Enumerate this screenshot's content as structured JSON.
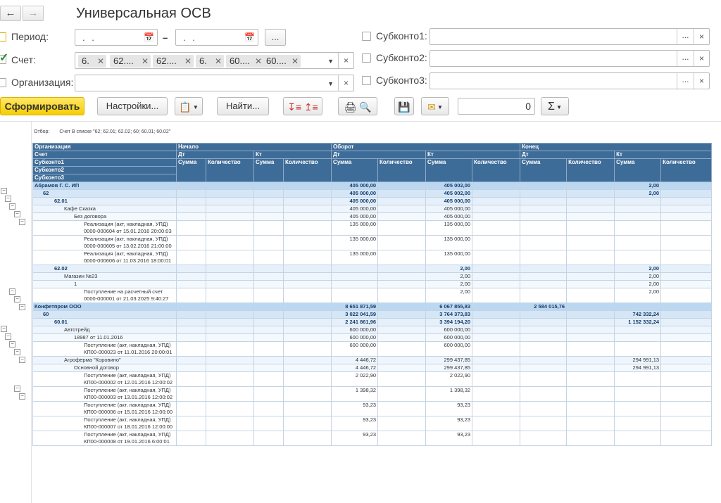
{
  "window": {
    "title": "Универсальная ОСВ"
  },
  "nav": {
    "back": "🡐",
    "forward": "🡒"
  },
  "form": {
    "period_label": "Период:",
    "period_from": ". .",
    "period_to": ". .",
    "period_dash": "–",
    "period_more": "...",
    "account_label": "Счет:",
    "account_chips": [
      "6.",
      "62....",
      "62....",
      "6.",
      "60....",
      "60...."
    ],
    "org_label": "Организация:",
    "sub1_label": "Субконто1:",
    "sub2_label": "Субконто2:",
    "sub3_label": "Субконто3:",
    "dots": "...",
    "clear": "×"
  },
  "toolbar": {
    "run": "Сформировать",
    "settings": "Настройки...",
    "find": "Найти...",
    "counter": "0"
  },
  "report": {
    "filter_label": "Отбор:",
    "filter_text": "Счет В списке \"62; 62.01; 62.02; 60; 60.01; 60.02\"",
    "header": {
      "org": "Организация",
      "account": "Счет",
      "sub1": "Субконто1",
      "sub2": "Субконто2",
      "sub3": "Субконто3",
      "start": "Начало",
      "turnover": "Оборот",
      "end": "Конец",
      "dt": "Дт",
      "kt": "Кт",
      "sum": "Сумма",
      "qty": "Количество"
    },
    "rows": [
      {
        "lvl": "l0",
        "indent": "",
        "name": "Абрамов Г. С. ИП",
        "v": [
          "",
          "",
          "",
          "",
          "405 000,00",
          "",
          "405 002,00",
          "",
          "",
          "",
          "2,00",
          ""
        ]
      },
      {
        "lvl": "l1",
        "indent": "i1",
        "name": "62",
        "v": [
          "",
          "",
          "",
          "",
          "405 000,00",
          "",
          "405 002,00",
          "",
          "",
          "",
          "2,00",
          ""
        ]
      },
      {
        "lvl": "l2",
        "indent": "i2",
        "name": "62.01",
        "v": [
          "",
          "",
          "",
          "",
          "405 000,00",
          "",
          "405 000,00",
          "",
          "",
          "",
          "",
          ""
        ]
      },
      {
        "lvl": "l3",
        "indent": "i3",
        "name": "Кафе Сказка",
        "v": [
          "",
          "",
          "",
          "",
          "405 000,00",
          "",
          "405 000,00",
          "",
          "",
          "",
          "",
          ""
        ]
      },
      {
        "lvl": "l4",
        "indent": "i4",
        "name": "Без договора",
        "v": [
          "",
          "",
          "",
          "",
          "405 000,00",
          "",
          "405 000,00",
          "",
          "",
          "",
          "",
          ""
        ]
      },
      {
        "lvl": "doc",
        "indent": "",
        "name": "Реализация (акт, накладная, УПД) 0000-000604 от 15.01.2016 20:00:03",
        "v": [
          "",
          "",
          "",
          "",
          "135 000,00",
          "",
          "135 000,00",
          "",
          "",
          "",
          "",
          ""
        ]
      },
      {
        "lvl": "doc",
        "indent": "",
        "name": "Реализация (акт, накладная, УПД) 0000-000605 от 13.02.2016 21:00:00",
        "v": [
          "",
          "",
          "",
          "",
          "135 000,00",
          "",
          "135 000,00",
          "",
          "",
          "",
          "",
          ""
        ]
      },
      {
        "lvl": "doc",
        "indent": "",
        "name": "Реализация (акт, накладная, УПД) 0000-000606 от 11.03.2016 18:00:01",
        "v": [
          "",
          "",
          "",
          "",
          "135 000,00",
          "",
          "135 000,00",
          "",
          "",
          "",
          "",
          ""
        ]
      },
      {
        "lvl": "l2",
        "indent": "i2",
        "name": "62.02",
        "v": [
          "",
          "",
          "",
          "",
          "",
          "",
          "2,00",
          "",
          "",
          "",
          "2,00",
          ""
        ]
      },
      {
        "lvl": "l3",
        "indent": "i3",
        "name": "Магазин №23",
        "v": [
          "",
          "",
          "",
          "",
          "",
          "",
          "2,00",
          "",
          "",
          "",
          "2,00",
          ""
        ]
      },
      {
        "lvl": "l4",
        "indent": "i4",
        "name": "1",
        "v": [
          "",
          "",
          "",
          "",
          "",
          "",
          "2,00",
          "",
          "",
          "",
          "2,00",
          ""
        ]
      },
      {
        "lvl": "doc",
        "indent": "",
        "name": "Поступление на расчетный счет 0000-000001 от 21.03.2025 9:40:27",
        "v": [
          "",
          "",
          "",
          "",
          "",
          "",
          "2,00",
          "",
          "",
          "",
          "2,00",
          ""
        ]
      },
      {
        "lvl": "l0",
        "indent": "",
        "name": "Конфетпром ООО",
        "v": [
          "",
          "",
          "",
          "",
          "8 651 871,59",
          "",
          "6 067 855,83",
          "",
          "2 584 015,76",
          "",
          "",
          ""
        ]
      },
      {
        "lvl": "l1",
        "indent": "i1",
        "name": "60",
        "v": [
          "",
          "",
          "",
          "",
          "3 022 041,59",
          "",
          "3 764 373,83",
          "",
          "",
          "",
          "742 332,24",
          ""
        ]
      },
      {
        "lvl": "l2",
        "indent": "i2",
        "name": "60.01",
        "v": [
          "",
          "",
          "",
          "",
          "2 241 861,96",
          "",
          "3 394 194,20",
          "",
          "",
          "",
          "1 152 332,24",
          ""
        ]
      },
      {
        "lvl": "l3",
        "indent": "i3",
        "name": "Автотрейд",
        "v": [
          "",
          "",
          "",
          "",
          "600 000,00",
          "",
          "600 000,00",
          "",
          "",
          "",
          "",
          ""
        ]
      },
      {
        "lvl": "l4",
        "indent": "i4",
        "name": "18987 от 11.01.2016",
        "v": [
          "",
          "",
          "",
          "",
          "600 000,00",
          "",
          "600 000,00",
          "",
          "",
          "",
          "",
          ""
        ]
      },
      {
        "lvl": "doc",
        "indent": "",
        "name": "Поступление (акт, накладная, УПД) КП00-000023 от 11.01.2016 20:00:01",
        "v": [
          "",
          "",
          "",
          "",
          "600 000,00",
          "",
          "600 000,00",
          "",
          "",
          "",
          "",
          ""
        ]
      },
      {
        "lvl": "l3",
        "indent": "i3",
        "name": "Агроферма \"Коровино\"",
        "v": [
          "",
          "",
          "",
          "",
          "4 446,72",
          "",
          "299 437,85",
          "",
          "",
          "",
          "294 991,13",
          ""
        ]
      },
      {
        "lvl": "l4",
        "indent": "i4",
        "name": "Основной договор",
        "v": [
          "",
          "",
          "",
          "",
          "4 446,72",
          "",
          "299 437,85",
          "",
          "",
          "",
          "294 991,13",
          ""
        ]
      },
      {
        "lvl": "doc",
        "indent": "",
        "name": "Поступление (акт, накладная, УПД) КП00-000002 от 12.01.2016 12:00:02",
        "v": [
          "",
          "",
          "",
          "",
          "2 022,90",
          "",
          "2 022,90",
          "",
          "",
          "",
          "",
          ""
        ]
      },
      {
        "lvl": "doc",
        "indent": "",
        "name": "Поступление (акт, накладная, УПД) КП00-000003 от 13.01.2016 12:00:02",
        "v": [
          "",
          "",
          "",
          "",
          "1 398,32",
          "",
          "1 398,32",
          "",
          "",
          "",
          "",
          ""
        ]
      },
      {
        "lvl": "doc",
        "indent": "",
        "name": "Поступление (акт, накладная, УПД) КП00-000006 от 15.01.2016 12:00:00",
        "v": [
          "",
          "",
          "",
          "",
          "93,23",
          "",
          "93,23",
          "",
          "",
          "",
          "",
          ""
        ]
      },
      {
        "lvl": "doc",
        "indent": "",
        "name": "Поступление (акт, накладная, УПД) КП00-000007 от 18.01.2016 12:00:00",
        "v": [
          "",
          "",
          "",
          "",
          "93,23",
          "",
          "93,23",
          "",
          "",
          "",
          "",
          ""
        ]
      },
      {
        "lvl": "doc",
        "indent": "",
        "name": "Поступление (акт, накладная, УПД) КП00-000008 от 19.01.2016 6:00:01",
        "v": [
          "",
          "",
          "",
          "",
          "93,23",
          "",
          "93,23",
          "",
          "",
          "",
          "",
          ""
        ]
      }
    ]
  }
}
